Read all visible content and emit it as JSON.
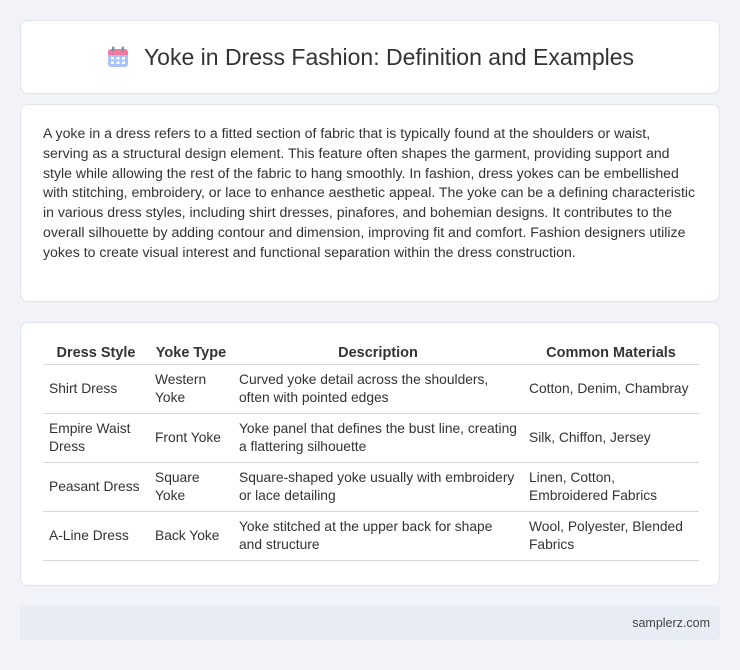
{
  "header": {
    "icon": "calendar-icon",
    "title": "Yoke in Dress Fashion: Definition and Examples"
  },
  "description": "A yoke in a dress refers to a fitted section of fabric that is typically found at the shoulders or waist, serving as a structural design element. This feature often shapes the garment, providing support and style while allowing the rest of the fabric to hang smoothly. In fashion, dress yokes can be embellished with stitching, embroidery, or lace to enhance aesthetic appeal. The yoke can be a defining characteristic in various dress styles, including shirt dresses, pinafores, and bohemian designs. It contributes to the overall silhouette by adding contour and dimension, improving fit and comfort. Fashion designers utilize yokes to create visual interest and functional separation within the dress construction.",
  "table": {
    "headers": [
      "Dress Style",
      "Yoke Type",
      "Description",
      "Common Materials"
    ],
    "rows": [
      [
        "Shirt Dress",
        "Western Yoke",
        "Curved yoke detail across the shoulders, often with pointed edges",
        "Cotton, Denim, Chambray"
      ],
      [
        "Empire Waist Dress",
        "Front Yoke",
        "Yoke panel that defines the bust line, creating a flattering silhouette",
        "Silk, Chiffon, Jersey"
      ],
      [
        "Peasant Dress",
        "Square Yoke",
        "Square-shaped yoke usually with embroidery or lace detailing",
        "Linen, Cotton, Embroidered Fabrics"
      ],
      [
        "A-Line Dress",
        "Back Yoke",
        "Yoke stitched at the upper back for shape and structure",
        "Wool, Polyester, Blended Fabrics"
      ]
    ]
  },
  "footer": {
    "site": "samplerz.com"
  },
  "colors": {
    "background": "#f1f3f8",
    "card": "#ffffff",
    "footer": "#e8ecf4",
    "icon_top": "#f07aa0",
    "icon_body": "#8fb3f5"
  }
}
